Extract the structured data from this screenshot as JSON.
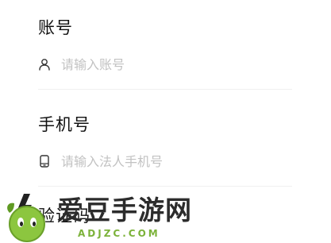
{
  "account": {
    "title": "账号",
    "placeholder": "请输入账号",
    "icon": "user-icon"
  },
  "phone": {
    "title": "手机号",
    "placeholder": "请输入法人手机号",
    "icon": "phone-icon"
  },
  "code": {
    "title": "验证码"
  },
  "watermark": {
    "brand": "爱豆手游网",
    "domain": "ADJZC.COM"
  },
  "colors": {
    "title": "#111111",
    "placeholder": "#c2c2c2",
    "divider": "#f0f0f0",
    "brand_green": "#7cb23a"
  }
}
